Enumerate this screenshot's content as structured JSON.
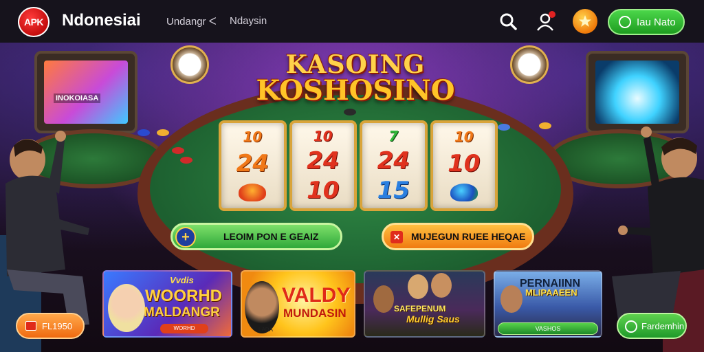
{
  "header": {
    "logo_text": "APK",
    "brand": "Ndonesiai",
    "nav": [
      "Undangr ᐸ",
      "Ndaysin"
    ],
    "icons": [
      "search-icon",
      "user-icon",
      "coin-icon"
    ],
    "login_label": "Iau Nato"
  },
  "stage": {
    "left_monitor_label": "INOKOIASA",
    "title_line1": "KASOING",
    "title_line2": "KOSHOSINO",
    "reels": [
      [
        {
          "v": "10",
          "c": "orange"
        },
        {
          "v": "24",
          "c": "orange"
        },
        {
          "v": "",
          "c": "orange"
        }
      ],
      [
        {
          "v": "10",
          "c": "red"
        },
        {
          "v": "24",
          "c": "red"
        },
        {
          "v": "10",
          "c": "red"
        }
      ],
      [
        {
          "v": "7",
          "c": "green"
        },
        {
          "v": "24",
          "c": "red"
        },
        {
          "v": "15",
          "c": "blue"
        }
      ],
      [
        {
          "v": "10",
          "c": "orange"
        },
        {
          "v": "10",
          "c": "red"
        },
        {
          "v": "",
          "c": "green"
        }
      ]
    ],
    "play_label": "LEOIM PON E GEAIZ",
    "promo_label": "MUJEGUN RUEE HEQAE"
  },
  "cards": [
    {
      "sub": "Vvdis",
      "title1": "WOORHD",
      "title2": "MALDANGR",
      "badge": "WORHD"
    },
    {
      "title1": "VALDY",
      "title2": "MUNDASIN",
      "small": "LADA"
    },
    {
      "title1": "SAFEPENUM",
      "title2": "Mullig Saus"
    },
    {
      "title1": "PERNAIINN",
      "title2": "MLIPAAEEN",
      "badge": "VASHOS"
    }
  ],
  "bottom": {
    "left_label": "FL1950",
    "right_label": "Fardemhin"
  },
  "colors": {
    "accent_green": "#2ea83a",
    "accent_orange": "#f07a10",
    "header_bg": "#16131c"
  }
}
